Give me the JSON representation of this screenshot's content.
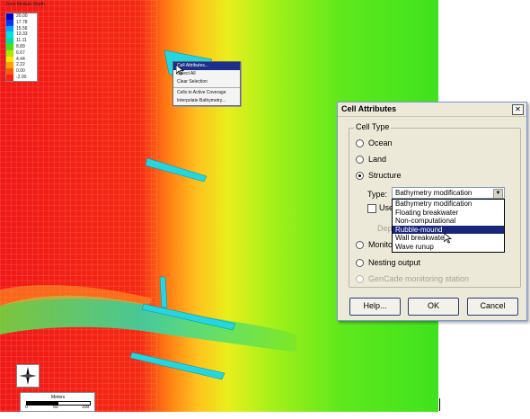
{
  "legend": {
    "title": "Zone Module Depth",
    "entries": [
      {
        "label": "20.00",
        "color": "#0000c8"
      },
      {
        "label": "17.78",
        "color": "#0033ff"
      },
      {
        "label": "15.56",
        "color": "#00a6ff"
      },
      {
        "label": "13.33",
        "color": "#00e1e1"
      },
      {
        "label": "11.11",
        "color": "#00e0a0"
      },
      {
        "label": "8.89",
        "color": "#4ce014"
      },
      {
        "label": "6.67",
        "color": "#b4e600"
      },
      {
        "label": "4.44",
        "color": "#ffe600"
      },
      {
        "label": "2.22",
        "color": "#ffa000"
      },
      {
        "label": "0.00",
        "color": "#ff5a00"
      },
      {
        "label": "-2.00",
        "color": "#ff1e14"
      }
    ]
  },
  "context_menu": {
    "items": [
      {
        "label": "Cell Attributes...",
        "highlight": true
      },
      {
        "label": "Select All",
        "highlight": false
      },
      {
        "label": "Clear Selection",
        "highlight": false
      },
      {
        "label": "Cells to Active Coverage",
        "highlight": false,
        "separator_before": true
      },
      {
        "label": "Interpolate Bathymetry...",
        "highlight": false
      }
    ]
  },
  "scale_bar": {
    "unit": "Meters",
    "ticks": [
      "0",
      "50",
      "100"
    ]
  },
  "dialog": {
    "title": "Cell Attributes",
    "close": "✕",
    "group_label": "Cell Type",
    "radios": [
      {
        "label": "Ocean",
        "checked": false,
        "disabled": false
      },
      {
        "label": "Land",
        "checked": false,
        "disabled": false
      },
      {
        "label": "Structure",
        "checked": true,
        "disabled": false
      },
      {
        "label": "Monito",
        "checked": false,
        "disabled": false
      },
      {
        "label": "Nesting output",
        "checked": false,
        "disabled": false
      },
      {
        "label": "GenCade monitoring station",
        "checked": false,
        "disabled": true
      }
    ],
    "type_label": "Type:",
    "type_value": "Bathymetry modification",
    "type_options": [
      "Bathymetry modification",
      "Floating breakwater",
      "Non-computational",
      "Rubble-mound",
      "Wall breakwater",
      "Wave runup"
    ],
    "type_selected_index": 3,
    "use_checkbox_label": "Use",
    "depth_label": "Dep",
    "buttons": {
      "help": "Help...",
      "ok": "OK",
      "cancel": "Cancel"
    }
  }
}
